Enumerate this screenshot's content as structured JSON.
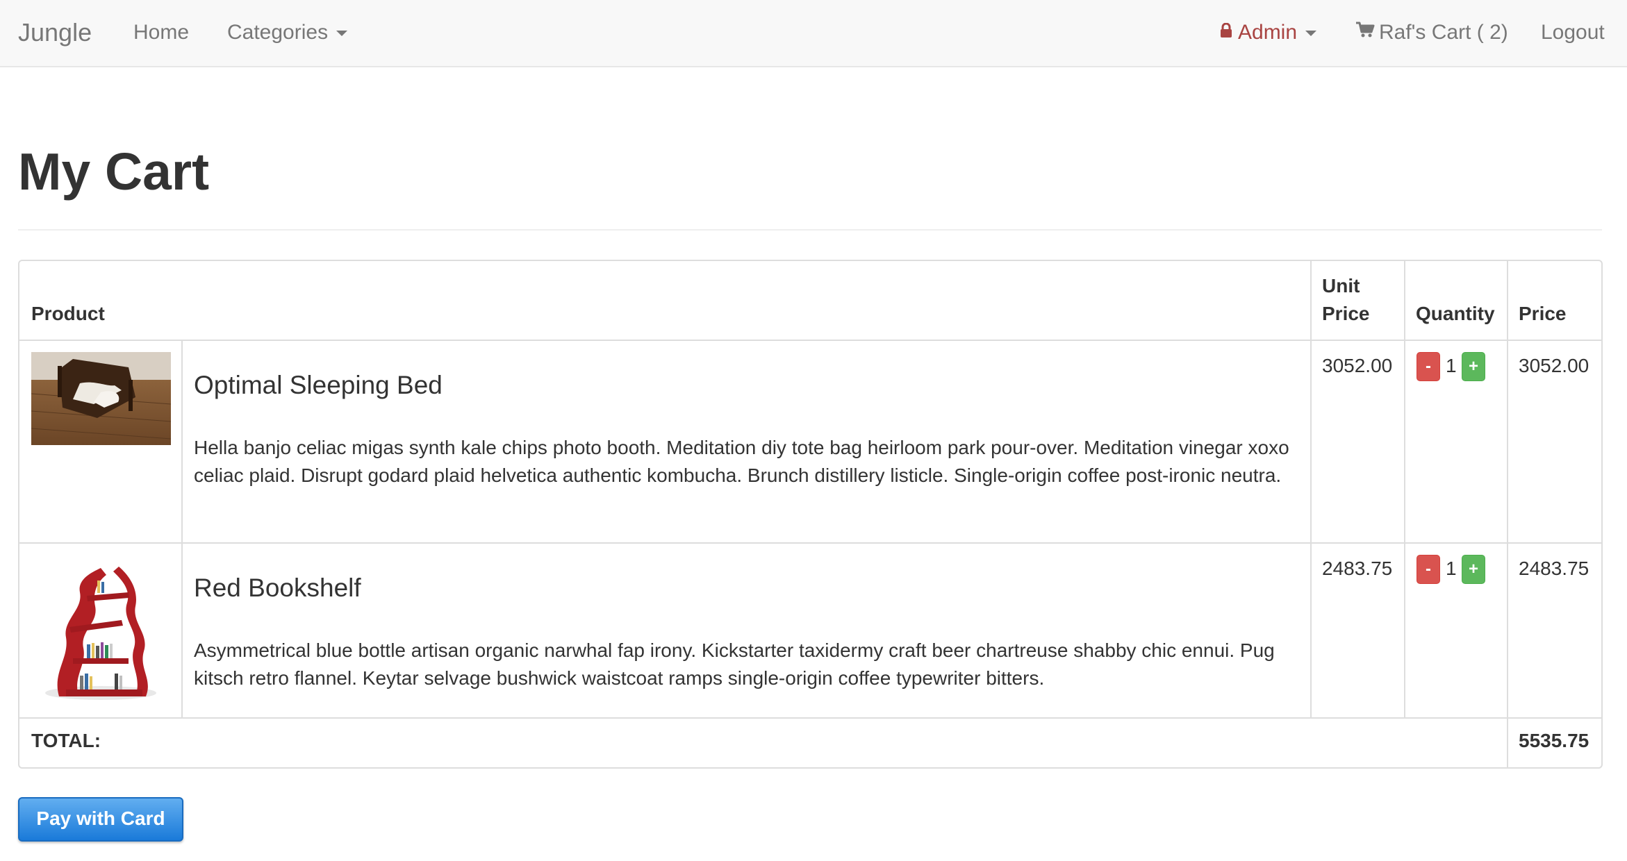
{
  "navbar": {
    "brand": "Jungle",
    "home": "Home",
    "categories": "Categories",
    "admin": "Admin",
    "cart": "Raf's Cart ( 2)",
    "logout": "Logout",
    "icons": {
      "lock": "lock-icon",
      "cart": "shopping-cart-icon",
      "caret": "caret-down-icon"
    }
  },
  "page": {
    "title": "My Cart"
  },
  "table": {
    "headers": {
      "product": "Product",
      "unit_price": "Unit\nPrice",
      "quantity": "Quantity",
      "price": "Price"
    },
    "rows": [
      {
        "name": "Optimal Sleeping Bed",
        "description": "Hella banjo celiac migas synth kale chips photo booth. Meditation diy tote bag heirloom park pour-over. Meditation vinegar xoxo celiac plaid. Disrupt godard plaid helvetica authentic kombucha. Brunch distillery listicle. Single-origin coffee post-ironic neutra.",
        "unit_price": "3052.00",
        "quantity": "1",
        "price": "3052.00",
        "image": "bed-photo"
      },
      {
        "name": "Red Bookshelf",
        "description": "Asymmetrical blue bottle artisan organic narwhal fap irony. Kickstarter taxidermy craft beer chartreuse shabby chic ennui. Pug kitsch retro flannel. Keytar selvage bushwick waistcoat ramps single-origin coffee typewriter bitters.",
        "unit_price": "2483.75",
        "quantity": "1",
        "price": "2483.75",
        "image": "bookshelf-photo"
      }
    ],
    "qty_minus": "-",
    "qty_plus": "+",
    "total_label": "TOTAL:",
    "total_value": "5535.75"
  },
  "pay_button": "Pay with Card",
  "colors": {
    "navbar_bg": "#f8f8f8",
    "admin": "#a94442",
    "minus_btn": "#d9534f",
    "plus_btn": "#5cb85c",
    "pay_btn": "#2d8ae4"
  }
}
